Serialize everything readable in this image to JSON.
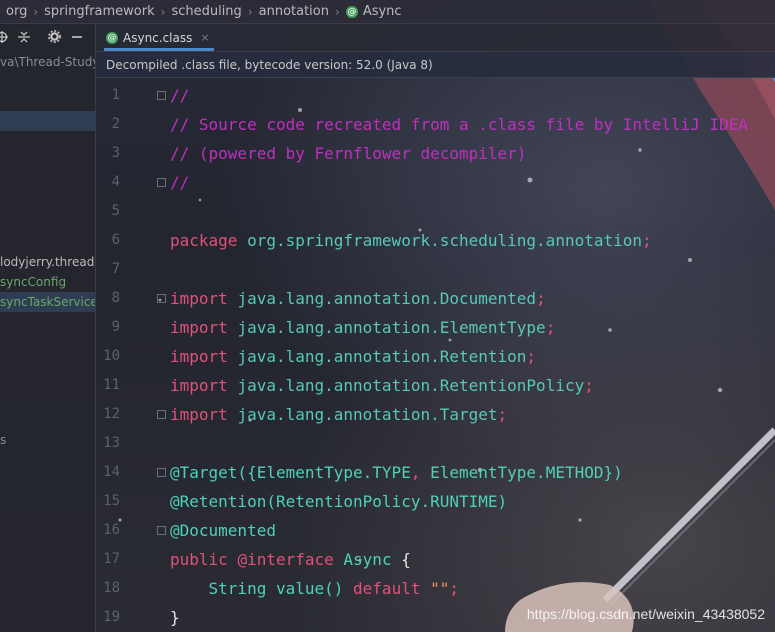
{
  "breadcrumb": {
    "items": [
      "org",
      "springframework",
      "scheduling",
      "annotation",
      "Async"
    ],
    "separator": "›"
  },
  "left_panel": {
    "toolbar_icons": [
      "target-icon",
      "collapse-icon",
      "gear-icon",
      "minimize-icon"
    ],
    "project_path": "va\\Thread-Study",
    "items": [
      {
        "label": "lodyjerry.thread",
        "style": "normal"
      },
      {
        "label": "syncConfig",
        "style": "green"
      },
      {
        "label": "syncTaskService",
        "style": "selected"
      }
    ],
    "marker": "s"
  },
  "tab": {
    "label": "Async.class",
    "close": "×"
  },
  "banner": {
    "text": "Decompiled .class file, bytecode version: 52.0 (Java 8)"
  },
  "code": {
    "line_numbers": [
      "1",
      "2",
      "3",
      "4",
      "5",
      "6",
      "7",
      "8",
      "9",
      "10",
      "11",
      "12",
      "13",
      "14",
      "15",
      "16",
      "17",
      "18",
      "19"
    ],
    "lines": [
      [
        {
          "t": "//",
          "c": "comment"
        }
      ],
      [
        {
          "t": "// Source code recreated from a .class file by IntelliJ IDEA",
          "c": "comment"
        }
      ],
      [
        {
          "t": "// (powered by Fernflower decompiler)",
          "c": "comment"
        }
      ],
      [
        {
          "t": "//",
          "c": "comment"
        }
      ],
      [],
      [
        {
          "t": "package ",
          "c": "kw"
        },
        {
          "t": "org.springframework.scheduling.annotation",
          "c": "pkg"
        },
        {
          "t": ";",
          "c": "semi"
        }
      ],
      [],
      [
        {
          "t": "import ",
          "c": "kw"
        },
        {
          "t": "java.lang.annotation.Documented",
          "c": "pkg"
        },
        {
          "t": ";",
          "c": "semi"
        }
      ],
      [
        {
          "t": "import ",
          "c": "kw"
        },
        {
          "t": "java.lang.annotation.ElementType",
          "c": "pkg"
        },
        {
          "t": ";",
          "c": "semi"
        }
      ],
      [
        {
          "t": "import ",
          "c": "kw"
        },
        {
          "t": "java.lang.annotation.Retention",
          "c": "pkg"
        },
        {
          "t": ";",
          "c": "semi"
        }
      ],
      [
        {
          "t": "import ",
          "c": "kw"
        },
        {
          "t": "java.lang.annotation.RetentionPolicy",
          "c": "pkg"
        },
        {
          "t": ";",
          "c": "semi"
        }
      ],
      [
        {
          "t": "import ",
          "c": "kw"
        },
        {
          "t": "java.lang.annotation.Target",
          "c": "pkg"
        },
        {
          "t": ";",
          "c": "semi"
        }
      ],
      [],
      [
        {
          "t": "@Target({ElementType.TYPE",
          "c": "anno"
        },
        {
          "t": ", ",
          "c": "semi"
        },
        {
          "t": "ElementType.METHOD})",
          "c": "anno"
        }
      ],
      [
        {
          "t": "@Retention(RetentionPolicy.RUNTIME)",
          "c": "anno"
        }
      ],
      [
        {
          "t": "@Documented",
          "c": "anno"
        }
      ],
      [
        {
          "t": "public ",
          "c": "kw"
        },
        {
          "t": "@interface ",
          "c": "kw"
        },
        {
          "t": "Async ",
          "c": "cls"
        },
        {
          "t": "{",
          "c": "brace"
        }
      ],
      [
        {
          "t": "    String value() ",
          "c": "plain"
        },
        {
          "t": "default ",
          "c": "kw"
        },
        {
          "t": "\"\"",
          "c": "str"
        },
        {
          "t": ";",
          "c": "semi"
        }
      ],
      [
        {
          "t": "}",
          "c": "brace"
        }
      ]
    ],
    "fold_lines": [
      1,
      4,
      8,
      12,
      14,
      16
    ]
  },
  "watermark": "https://blog.csdn.net/weixin_43438052"
}
